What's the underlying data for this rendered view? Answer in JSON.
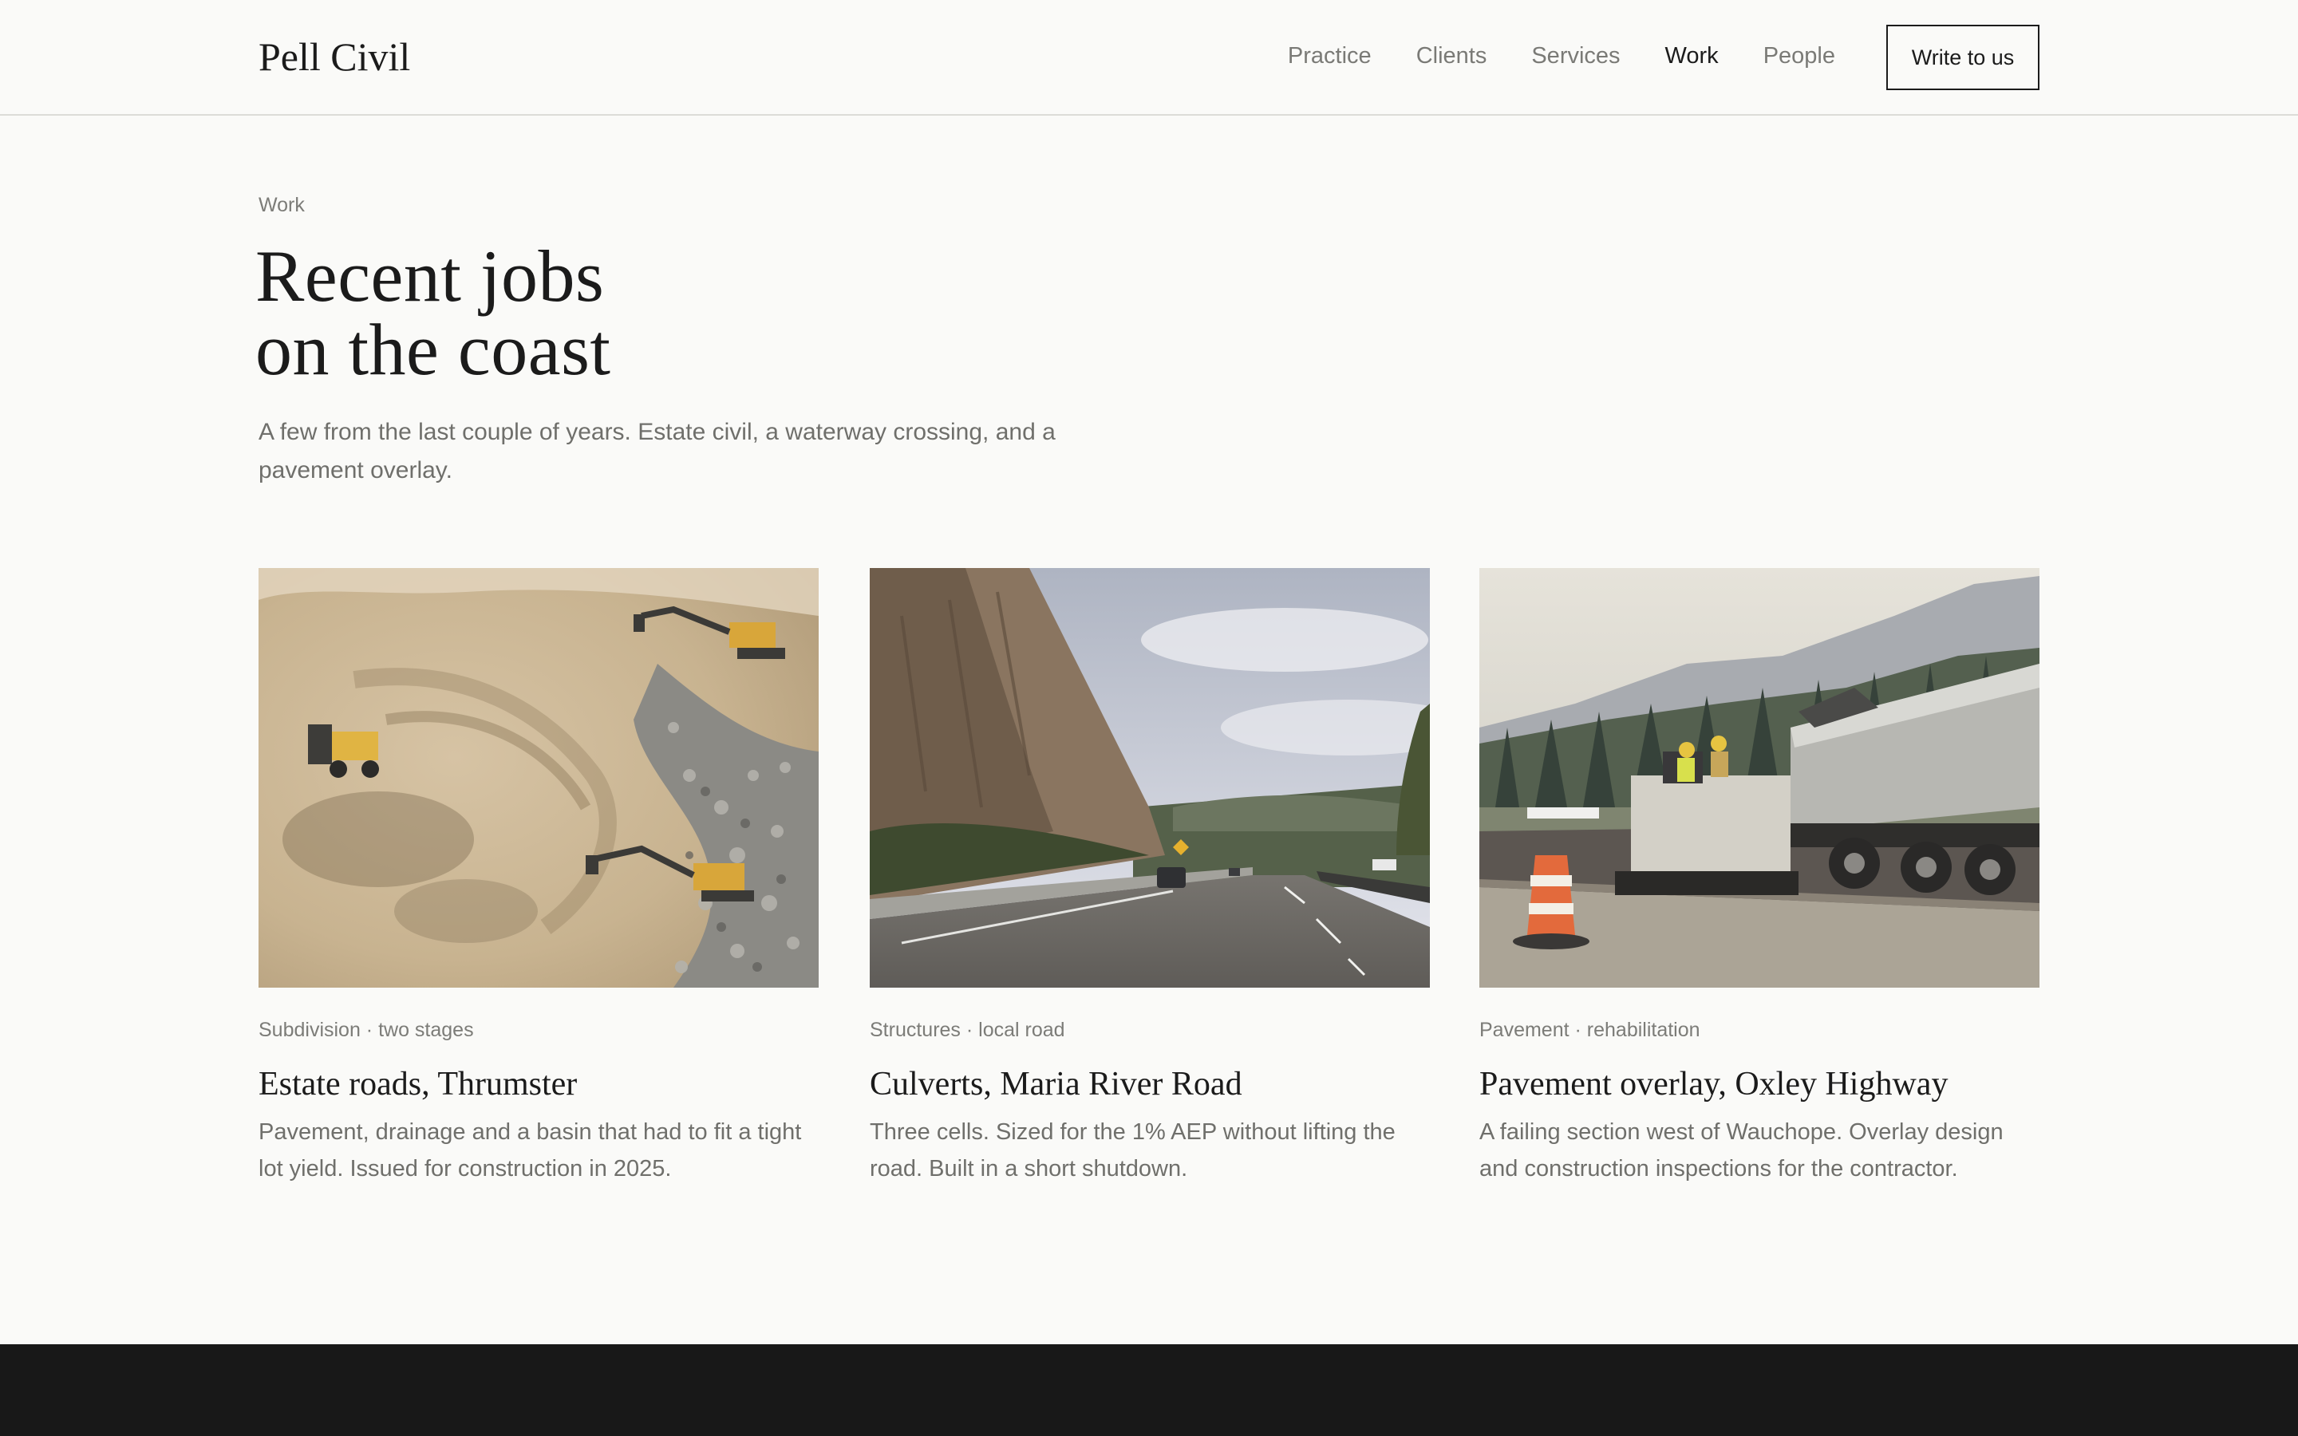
{
  "brand": {
    "name": "Pell Civil"
  },
  "nav": {
    "items": [
      {
        "label": "Practice",
        "active": false
      },
      {
        "label": "Clients",
        "active": false
      },
      {
        "label": "Services",
        "active": false
      },
      {
        "label": "Work",
        "active": true
      },
      {
        "label": "People",
        "active": false
      }
    ],
    "cta_label": "Write to us"
  },
  "hero": {
    "eyebrow": "Work",
    "headline_line1": "Recent jobs",
    "headline_line2": "on the coast",
    "lede": "A few from the last couple of years. Estate civil, a waterway crossing, and a pavement overlay."
  },
  "projects": [
    {
      "tag": "Subdivision · two stages",
      "title": "Estate roads, Thrumster",
      "body": "Pavement, drainage and a basin that had to fit a tight lot yield. Issued for construction in 2025.",
      "image": "aerial-earthworks-excavators-photo"
    },
    {
      "tag": "Structures · local road",
      "title": "Culverts, Maria River Road",
      "body": "Three cells. Sized for the 1% AEP without lifting the road. Built in a short shutdown.",
      "image": "highway-cliff-cutting-photo"
    },
    {
      "tag": "Pavement · rehabilitation",
      "title": "Pavement overlay, Oxley Highway",
      "body": "A failing section west of Wauchope. Overlay design and construction inspections for the contractor.",
      "image": "asphalt-paver-truck-photo"
    }
  ],
  "colors": {
    "background": "#fafaf8",
    "text": "#1b1b1b",
    "muted": "#7a7a76",
    "footer": "#181818"
  }
}
